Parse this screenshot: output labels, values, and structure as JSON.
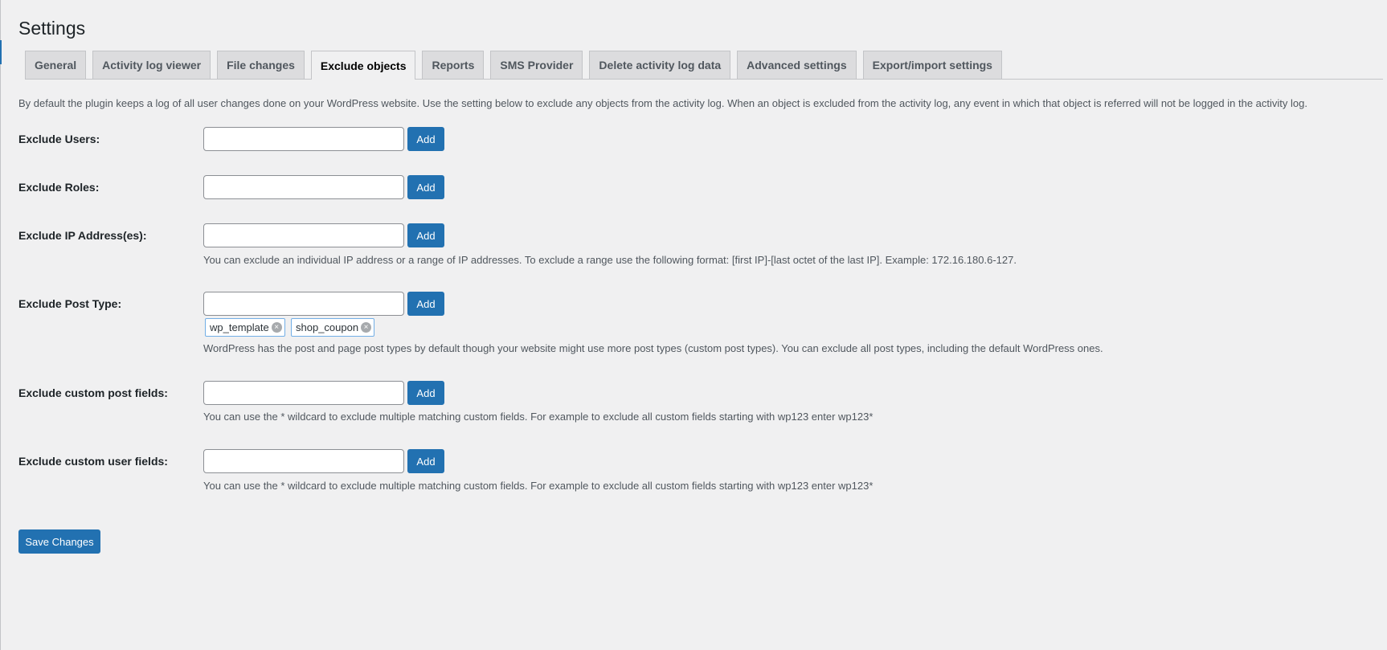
{
  "page": {
    "title": "Settings"
  },
  "tabs": [
    {
      "label": "General"
    },
    {
      "label": "Activity log viewer"
    },
    {
      "label": "File changes"
    },
    {
      "label": "Exclude objects",
      "active": true
    },
    {
      "label": "Reports"
    },
    {
      "label": "SMS Provider"
    },
    {
      "label": "Delete activity log data"
    },
    {
      "label": "Advanced settings"
    },
    {
      "label": "Export/import settings"
    }
  ],
  "intro": "By default the plugin keeps a log of all user changes done on your WordPress website. Use the setting below to exclude any objects from the activity log. When an object is excluded from the activity log, any event in which that object is referred will not be logged in the activity log.",
  "add_label": "Add",
  "fields": {
    "users": {
      "label": "Exclude Users:",
      "value": ""
    },
    "roles": {
      "label": "Exclude Roles:",
      "value": ""
    },
    "ip": {
      "label": "Exclude IP Address(es):",
      "value": "",
      "help": "You can exclude an individual IP address or a range of IP addresses. To exclude a range use the following format: [first IP]-[last octet of the last IP]. Example: 172.16.180.6-127."
    },
    "post_type": {
      "label": "Exclude Post Type:",
      "value": "",
      "tags": [
        "wp_template",
        "shop_coupon"
      ],
      "help": "WordPress has the post and page post types by default though your website might use more post types (custom post types). You can exclude all post types, including the default WordPress ones."
    },
    "custom_post_fields": {
      "label": "Exclude custom post fields:",
      "value": "",
      "help": "You can use the * wildcard to exclude multiple matching custom fields. For example to exclude all custom fields starting with wp123 enter wp123*"
    },
    "custom_user_fields": {
      "label": "Exclude custom user fields:",
      "value": "",
      "help": "You can use the * wildcard to exclude multiple matching custom fields. For example to exclude all custom fields starting with wp123 enter wp123*"
    }
  },
  "save_label": "Save Changes",
  "colors": {
    "accent": "#2271b1",
    "background": "#f0f0f1",
    "tag_border": "#72aee6"
  }
}
